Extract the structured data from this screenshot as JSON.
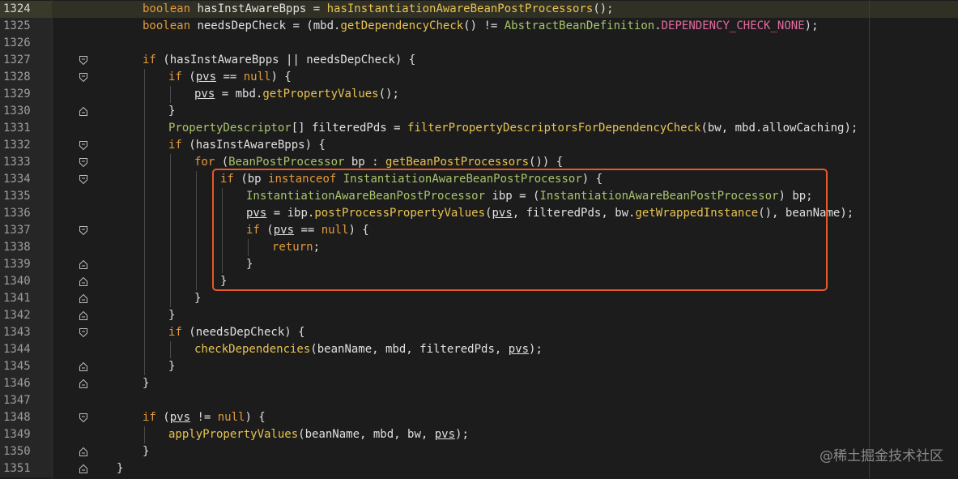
{
  "editor": {
    "lines": [
      {
        "n": "1324",
        "current": true,
        "fold": "none",
        "indent": 1,
        "tokens": [
          [
            "kw",
            "boolean"
          ],
          [
            "",
            ""
          ],
          [
            "",
            " hasInstAwareBpps = "
          ],
          [
            "fn",
            "hasInstantiationAwareBeanPostProcessors"
          ],
          [
            "",
            "();"
          ]
        ]
      },
      {
        "n": "1325",
        "fold": "none",
        "indent": 1,
        "tokens": [
          [
            "kw",
            "boolean"
          ],
          [
            "",
            " needsDepCheck = (mbd."
          ],
          [
            "fn",
            "getDependencyCheck"
          ],
          [
            "",
            "() != "
          ],
          [
            "ty",
            "AbstractBeanDefinition"
          ],
          [
            "",
            "."
          ],
          [
            "cs",
            "DEPENDENCY_CHECK_NONE"
          ],
          [
            "",
            ");"
          ]
        ]
      },
      {
        "n": "1326",
        "fold": "none",
        "indent": 0,
        "tokens": []
      },
      {
        "n": "1327",
        "fold": "open",
        "indent": 1,
        "tokens": [
          [
            "kw",
            "if"
          ],
          [
            "",
            " (hasInstAwareBpps || needsDepCheck) {"
          ]
        ]
      },
      {
        "n": "1328",
        "fold": "open",
        "indent": 2,
        "tokens": [
          [
            "kw",
            "if"
          ],
          [
            "",
            " ("
          ],
          [
            "vr",
            "pvs"
          ],
          [
            "",
            " == "
          ],
          [
            "kw",
            "null"
          ],
          [
            "",
            ") {"
          ]
        ]
      },
      {
        "n": "1329",
        "fold": "none",
        "indent": 3,
        "tokens": [
          [
            "vr",
            "pvs"
          ],
          [
            "",
            " = mbd."
          ],
          [
            "fn",
            "getPropertyValues"
          ],
          [
            "",
            "();"
          ]
        ]
      },
      {
        "n": "1330",
        "fold": "close",
        "indent": 2,
        "tokens": [
          [
            "",
            "}"
          ]
        ]
      },
      {
        "n": "1331",
        "fold": "none",
        "indent": 2,
        "tokens": [
          [
            "ty",
            "PropertyDescriptor"
          ],
          [
            "",
            "[] filteredPds = "
          ],
          [
            "fn",
            "filterPropertyDescriptorsForDependencyCheck"
          ],
          [
            "",
            "(bw, mbd.allowCaching);"
          ]
        ]
      },
      {
        "n": "1332",
        "fold": "open",
        "indent": 2,
        "tokens": [
          [
            "kw",
            "if"
          ],
          [
            "",
            " (hasInstAwareBpps) {"
          ]
        ]
      },
      {
        "n": "1333",
        "fold": "open",
        "indent": 3,
        "tokens": [
          [
            "kw",
            "for"
          ],
          [
            "",
            " ("
          ],
          [
            "ty",
            "BeanPostProcessor"
          ],
          [
            "",
            " bp : "
          ],
          [
            "fn",
            "getBeanPostProcessors"
          ],
          [
            "",
            "()) {"
          ]
        ]
      },
      {
        "n": "1334",
        "fold": "open",
        "indent": 4,
        "tokens": [
          [
            "kw",
            "if"
          ],
          [
            "",
            " (bp "
          ],
          [
            "kw",
            "instanceof"
          ],
          [
            "",
            " "
          ],
          [
            "ty",
            "InstantiationAwareBeanPostProcessor"
          ],
          [
            "",
            ") {"
          ]
        ]
      },
      {
        "n": "1335",
        "fold": "none",
        "indent": 5,
        "tokens": [
          [
            "ty",
            "InstantiationAwareBeanPostProcessor"
          ],
          [
            "",
            " ibp = ("
          ],
          [
            "ty",
            "InstantiationAwareBeanPostProcessor"
          ],
          [
            "",
            ") bp;"
          ]
        ]
      },
      {
        "n": "1336",
        "fold": "none",
        "indent": 5,
        "tokens": [
          [
            "vr",
            "pvs"
          ],
          [
            "",
            " = ibp."
          ],
          [
            "fn",
            "postProcessPropertyValues"
          ],
          [
            "",
            "("
          ],
          [
            "vr",
            "pvs"
          ],
          [
            "",
            ", filteredPds, bw."
          ],
          [
            "fn",
            "getWrappedInstance"
          ],
          [
            "",
            "(), beanName);"
          ]
        ]
      },
      {
        "n": "1337",
        "fold": "open",
        "indent": 5,
        "tokens": [
          [
            "kw",
            "if"
          ],
          [
            "",
            " ("
          ],
          [
            "vr",
            "pvs"
          ],
          [
            "",
            " == "
          ],
          [
            "kw",
            "null"
          ],
          [
            "",
            ") {"
          ]
        ]
      },
      {
        "n": "1338",
        "fold": "none",
        "indent": 6,
        "tokens": [
          [
            "kw",
            "return"
          ],
          [
            "",
            ";"
          ]
        ]
      },
      {
        "n": "1339",
        "fold": "close",
        "indent": 5,
        "tokens": [
          [
            "",
            "}"
          ]
        ]
      },
      {
        "n": "1340",
        "fold": "close",
        "indent": 4,
        "tokens": [
          [
            "",
            "}"
          ]
        ]
      },
      {
        "n": "1341",
        "fold": "close",
        "indent": 3,
        "tokens": [
          [
            "",
            "}"
          ]
        ]
      },
      {
        "n": "1342",
        "fold": "close",
        "indent": 2,
        "tokens": [
          [
            "",
            "}"
          ]
        ]
      },
      {
        "n": "1343",
        "fold": "open",
        "indent": 2,
        "tokens": [
          [
            "kw",
            "if"
          ],
          [
            "",
            " (needsDepCheck) {"
          ]
        ]
      },
      {
        "n": "1344",
        "fold": "none",
        "indent": 3,
        "tokens": [
          [
            "fn",
            "checkDependencies"
          ],
          [
            "",
            "(beanName, mbd, filteredPds, "
          ],
          [
            "vr",
            "pvs"
          ],
          [
            "",
            ");"
          ]
        ]
      },
      {
        "n": "1345",
        "fold": "close",
        "indent": 2,
        "tokens": [
          [
            "",
            "}"
          ]
        ]
      },
      {
        "n": "1346",
        "fold": "close",
        "indent": 1,
        "tokens": [
          [
            "",
            "}"
          ]
        ]
      },
      {
        "n": "1347",
        "fold": "none",
        "indent": 0,
        "tokens": []
      },
      {
        "n": "1348",
        "fold": "open",
        "indent": 1,
        "tokens": [
          [
            "kw",
            "if"
          ],
          [
            "",
            " ("
          ],
          [
            "vr",
            "pvs"
          ],
          [
            "",
            " != "
          ],
          [
            "kw",
            "null"
          ],
          [
            "",
            ") {"
          ]
        ]
      },
      {
        "n": "1349",
        "fold": "none",
        "indent": 2,
        "tokens": [
          [
            "fn",
            "applyPropertyValues"
          ],
          [
            "",
            "(beanName, mbd, bw, "
          ],
          [
            "vr",
            "pvs"
          ],
          [
            "",
            ");"
          ]
        ]
      },
      {
        "n": "1350",
        "fold": "close",
        "indent": 1,
        "tokens": [
          [
            "",
            "}"
          ]
        ]
      },
      {
        "n": "1351",
        "fold": "close",
        "indent": 0,
        "tokens": [
          [
            "",
            "}"
          ]
        ]
      }
    ]
  },
  "watermark": "@稀土掘金技术社区",
  "colors": {
    "keyword": "#e39b3c",
    "function": "#e8c351",
    "type": "#a8c46b",
    "constant": "#e46aa0",
    "highlight_border": "#e45a28"
  }
}
